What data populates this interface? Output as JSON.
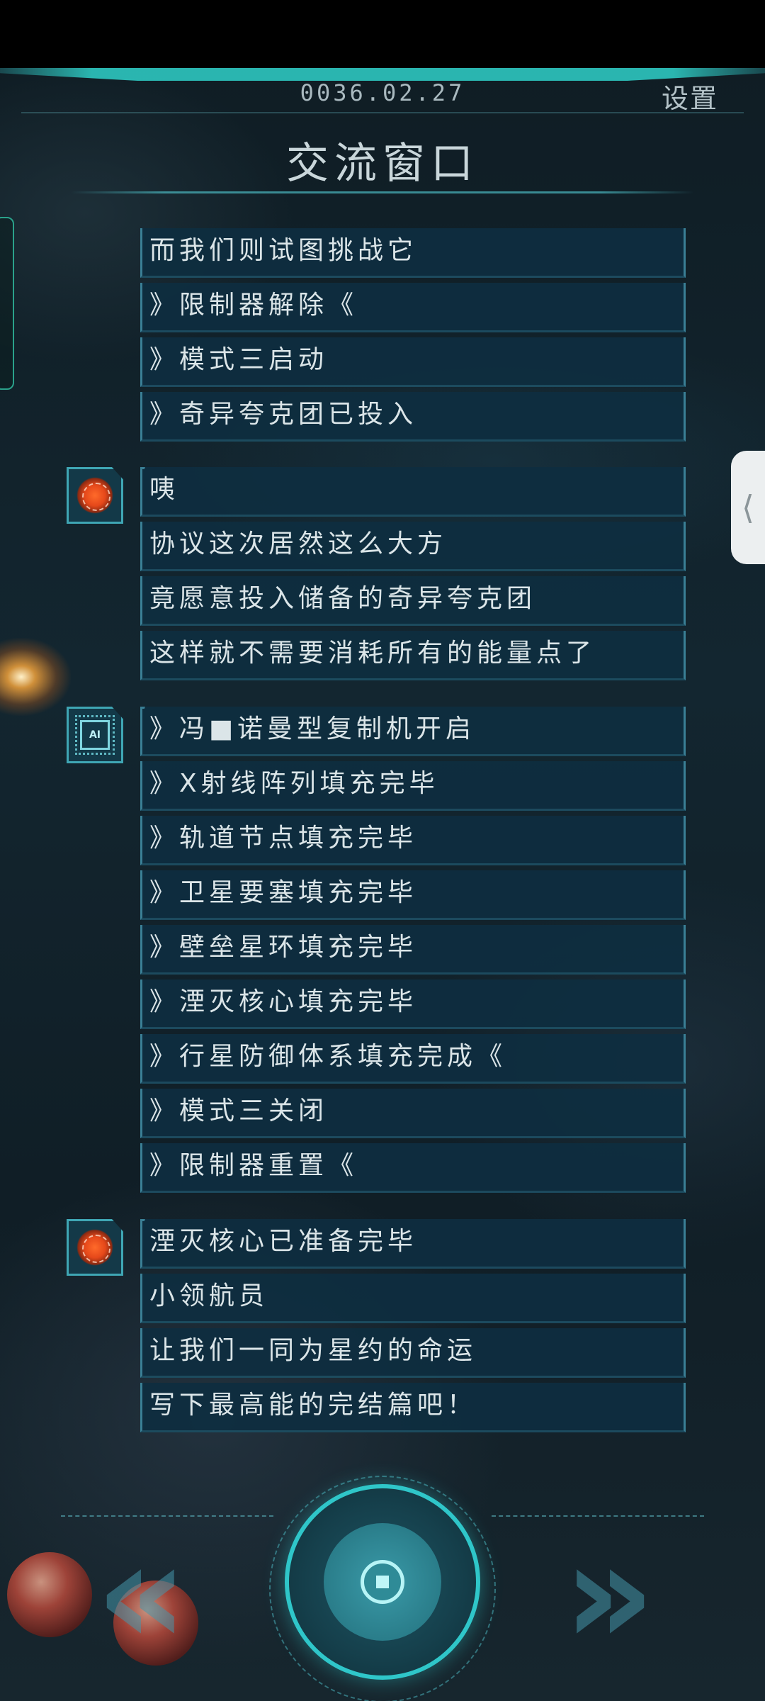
{
  "header": {
    "date": "0036.02.27",
    "settings_label": "设置",
    "title": "交流窗口"
  },
  "side_handle": {
    "icon": "chevron-left-icon",
    "glyph": "⟨"
  },
  "messages": [
    {
      "avatar": null,
      "lines": [
        "而我们则试图挑战它",
        "》限制器解除《",
        "》模式三启动",
        "》奇异夸克团已投入"
      ]
    },
    {
      "avatar": "brain-avatar-icon",
      "lines": [
        "咦",
        "协议这次居然这么大方",
        "竟愿意投入储备的奇异夸克团",
        "这样就不需要消耗所有的能量点了"
      ]
    },
    {
      "avatar": "ai-chip-avatar-icon",
      "avatar_text": "AI",
      "lines": [
        "》冯■诺曼型复制机开启",
        "》X射线阵列填充完毕",
        "》轨道节点填充完毕",
        "》卫星要塞填充完毕",
        "》壁垒星环填充完毕",
        "》湮灭核心填充完毕",
        "》行星防御体系填充完成《",
        "》模式三关闭",
        "》限制器重置《"
      ]
    },
    {
      "avatar": "brain-avatar-icon",
      "lines": [
        "湮灭核心已准备完毕",
        "小领航员",
        "让我们一同为星约的命运",
        "写下最高能的完结篇吧！"
      ]
    }
  ],
  "controls": {
    "prev_icon": "double-chevron-left-icon",
    "prev_glyph": "«",
    "next_icon": "double-chevron-right-icon",
    "next_glyph": "»",
    "center_icon": "action-button-icon"
  },
  "colors": {
    "accent": "#2fc6c9",
    "bubble": "#0e2e40",
    "bubble_border": "#3a7f95",
    "text": "#dbe5e8"
  }
}
